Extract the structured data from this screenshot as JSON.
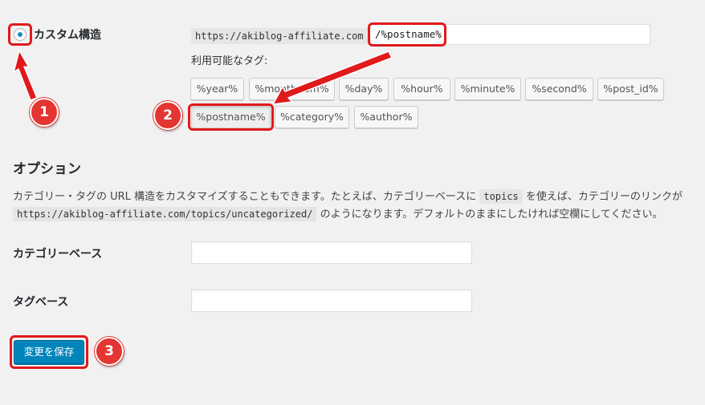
{
  "structure": {
    "radio_label": "カスタム構造",
    "base_url": "https://akiblog-affiliate.com",
    "value": "/%postname%",
    "available_tags_label": "利用可能なタグ:"
  },
  "tags_row1": [
    "%year%",
    "%monthnum%",
    "%day%",
    "%hour%",
    "%minute%",
    "%second%",
    "%post_id%"
  ],
  "tags_row2": [
    "%postname%",
    "%category%",
    "%author%"
  ],
  "options": {
    "title": "オプション",
    "desc_part1": "カテゴリー・タグの URL 構造をカスタマイズすることもできます。たとえば、カテゴリーベースに",
    "desc_code1": "topics",
    "desc_part2": "を使えば、カテゴリーのリンクが",
    "desc_code2": "https://akiblog-affiliate.com/topics/uncategorized/",
    "desc_part3": "のようになります。デフォルトのままにしたければ空欄にしてください。",
    "category_base_label": "カテゴリーベース",
    "tag_base_label": "タグベース"
  },
  "save_label": "変更を保存",
  "badges": [
    "1",
    "2",
    "3"
  ],
  "colors": {
    "annotation_red": "#e0191b",
    "primary_button": "#0085ba",
    "radio_dot": "#1e8cbe"
  }
}
